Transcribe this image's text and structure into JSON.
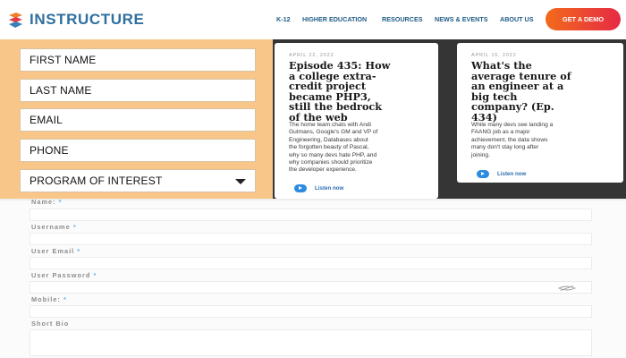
{
  "header": {
    "logo_text": "INSTRUCTURE",
    "nav": [
      "K-12",
      "HIGHER EDUCATION",
      "RESOURCES",
      "NEWS & EVENTS",
      "ABOUT US"
    ],
    "cta_label": "GET A DEMO"
  },
  "lead_form": {
    "fields": [
      "FIRST NAME",
      "LAST NAME",
      "EMAIL",
      "PHONE"
    ],
    "select_label": "PROGRAM OF INTEREST"
  },
  "articles": [
    {
      "date": "APRIL 22, 2022",
      "title": "Episode 435: How a college extra-credit project became PHP3, still the bedrock of the web",
      "title_lines": [
        "Episode 435: How",
        "a college extra-",
        "credit project",
        "became PHP3,",
        "still the bedrock",
        "of the web"
      ],
      "body_lines": [
        "The home team chats with Andi",
        "Gutmans, Google's GM and VP of",
        "Engineering, Databases about",
        "the forgotten beauty of Pascal,",
        "why so many devs hate PHP, and",
        "why companies should prioritize",
        "the developer experience."
      ],
      "listen_label": "Listen now"
    },
    {
      "date": "APRIL 15, 2022",
      "title": "What's the average tenure of an engineer at a big tech company? (Ep. 434)",
      "title_lines": [
        "What's the",
        "average tenure of",
        "an engineer at a",
        "big tech",
        "company? (Ep.",
        "434)"
      ],
      "body_lines": [
        "While many devs see landing a",
        "FAANG job as a major",
        "achievement, the data shows",
        "many don't stay long after",
        "joining."
      ],
      "listen_label": "Listen now"
    }
  ],
  "profile_form": {
    "fields": [
      {
        "label": "Name:",
        "required_mark": "*"
      },
      {
        "label": "Username",
        "required_mark": "*"
      },
      {
        "label": "User Email",
        "required_mark": "*"
      },
      {
        "label": "User Password",
        "required_mark": "*"
      },
      {
        "label": "Mobile:",
        "required_mark": "*"
      },
      {
        "label": "Short Bio",
        "required_mark": ""
      }
    ]
  },
  "colors": {
    "brand_blue": "#2f6f9f",
    "cta_start": "#f36a1b",
    "cta_end": "#e62a45",
    "form_panel": "#f9c68a",
    "article_band": "#353535",
    "link_blue": "#2d8be0"
  },
  "icons": {
    "logo": "instructure-logo-icon",
    "select": "chevron-down-icon",
    "listen": "play-icon",
    "password": "eye-icon"
  }
}
